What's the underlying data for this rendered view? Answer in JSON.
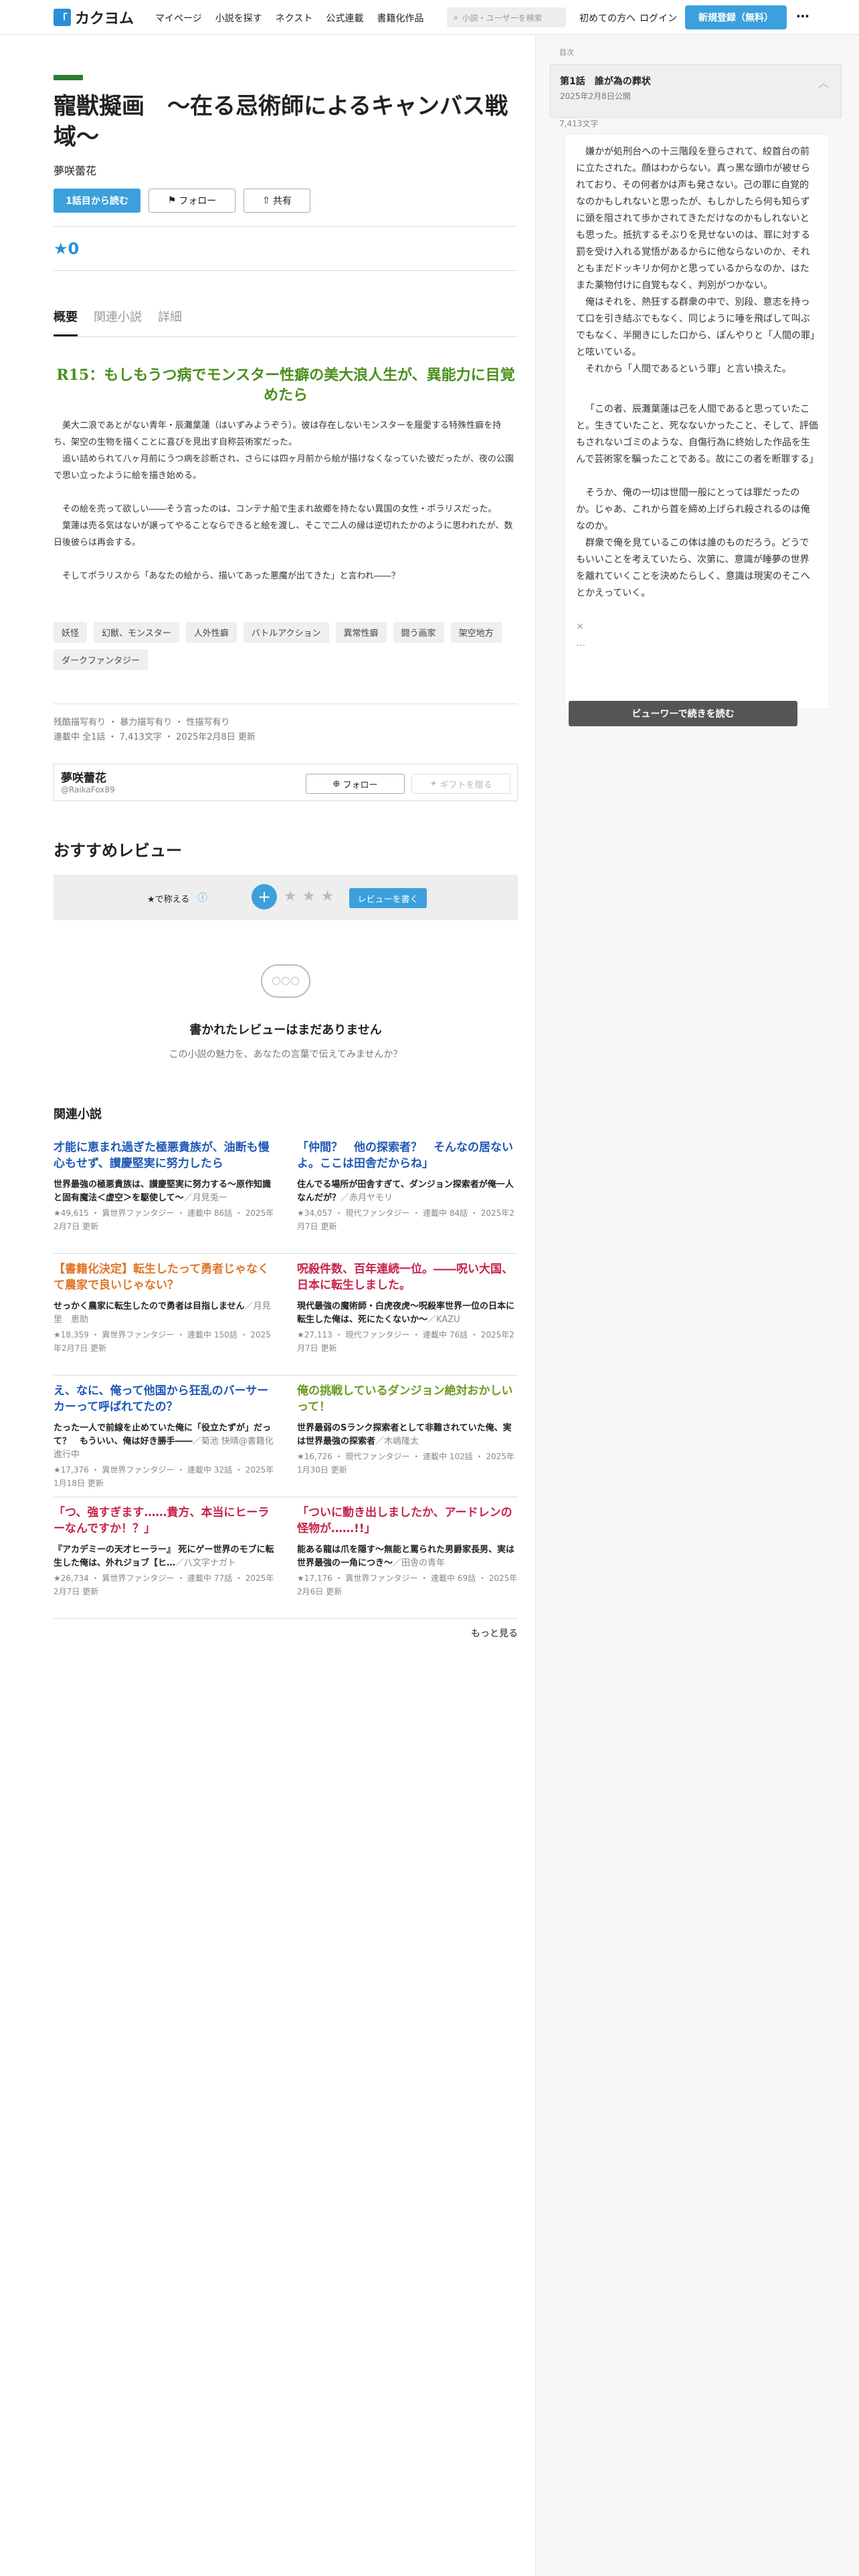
{
  "header": {
    "logo": "カクヨム",
    "nav": [
      "マイページ",
      "小説を探す",
      "ネクスト",
      "公式連載",
      "書籍化作品"
    ],
    "search_placeholder": "小説・ユーザーを検索",
    "beginner": "初めての方へ",
    "login": "ログイン",
    "signup": "新規登録（無料）"
  },
  "work": {
    "title": "寵獣擬画　〜在る忌術師によるキャンバス戦域〜",
    "author": "夢咲蕾花",
    "read_first": "1話目から読む",
    "follow": "フォロー",
    "share": "共有",
    "rating": "★0",
    "tabs": [
      "概要",
      "関連小説",
      "詳細"
    ],
    "catchphrase": "R15：もしもうつ病でモンスター性癖の美大浪人生が、異能力に目覚めたら",
    "intro": [
      "美大二浪であとがない青年・辰灘葉蓮（はいずみようぞう）。彼は存在しないモンスターを履愛する特殊性癖を持ち、架空の生物を描くことに喜びを見出す自称芸術家だった。",
      "追い詰められて八ヶ月前にうつ病を診断され、さらには四ヶ月前から絵が描けなくなっていた彼だったが、夜の公園で思い立ったように絵を描き始める。",
      "",
      "その絵を売って欲しい――そう言ったのは、コンテナ船で生まれ故郷を持たない異国の女性・ポラリスだった。",
      "葉蓮は売る気はないが譲ってやることならできると絵を渡し、そこで二人の縁は逆切れたかのように思われたが、数日後彼らは再会する。",
      "",
      "そしてポラリスから「あなたの絵から、描いてあった悪魔が出てきた」と言われ――？"
    ],
    "tags": [
      "妖怪",
      "幻獣、モンスター",
      "人外性癖",
      "バトルアクション",
      "異常性癖",
      "闘う画家",
      "架空地方",
      "ダークファンタジー"
    ],
    "notices": "残酷描写有り ・ 暴力描写有り ・ 性描写有り",
    "status": "連載中 全1話 ・ 7,413文字 ・ 2025年2月8日 更新",
    "author_box": {
      "name": "夢咲蕾花",
      "id": "@RaikaFox89",
      "follow": "フォロー",
      "gift": "ギフトを贈る"
    }
  },
  "reviews": {
    "heading": "おすすめレビュー",
    "star_label": "★で称える",
    "write": "レビューを書く",
    "empty_title": "書かれたレビューはまだありません",
    "empty_sub": "この小説の魅力を、あなたの言葉で伝えてみませんか？"
  },
  "related": {
    "heading": "関連小説",
    "items": [
      {
        "title": "才能に恵まれ過ぎた極悪貴族が、油断も慢心もせず、讃慶堅実に努力したら",
        "color": "#1f59b5",
        "sub": "世界最強の極悪貴族は、讃慶堅実に努力する〜原作知識と固有魔法＜虚空＞を駆使して〜",
        "author": "／月見兎一",
        "meta": "★49,615 ・ 異世界ファンタジー ・ 連載中 86話 ・ 2025年2月7日 更新"
      },
      {
        "title": "「仲間？　他の探索者？　そんなの居ないよ。ここは田舎だからね」",
        "color": "#1f59b5",
        "sub": "住んでる場所が田舎すぎて、ダンジョン探索者が俺一人なんだが？",
        "author": "／赤月ヤモリ",
        "meta": "★34,057 ・ 現代ファンタジー ・ 連載中 84話 ・ 2025年2月7日 更新"
      },
      {
        "title": "【書籍化決定】転生したって勇者じゃなくて農家で良いじゃない？",
        "color": "#e0762a",
        "sub": "せっかく農家に転生したので勇者は目指しません",
        "author": "／月見里　恵助",
        "meta": "★18,359 ・ 異世界ファンタジー ・ 連載中 150話 ・ 2025年2月7日 更新"
      },
      {
        "title": "呪殺件数、百年連続一位。――呪い大国、日本に転生しました。",
        "color": "#c8224a",
        "sub": "現代最強の魔術師・白虎夜虎〜呪殺率世界一位の日本に転生した俺は、死にたくないか〜",
        "author": "／KAZU",
        "meta": "★27,113 ・ 現代ファンタジー ・ 連載中 76話 ・ 2025年2月7日 更新"
      },
      {
        "title": "え、なに、俺って他国から狂乱のバーサーカーって呼ばれてたの？",
        "color": "#1f59b5",
        "sub": "たった一人で前線を止めていた俺に「役立たずが」だって？　もういい、俺は好き勝手――",
        "author": "／菊池 快晴@書籍化進行中",
        "meta": "★17,376 ・ 異世界ファンタジー ・ 連載中 32話 ・ 2025年1月18日 更新"
      },
      {
        "title": "俺の挑戦しているダンジョン絶対おかしいって！",
        "color": "#6a9a1e",
        "sub": "世界最弱のSランク探索者として非難されていた俺、実は世界最強の探索者",
        "author": "／木嶋隆太",
        "meta": "★16,726 ・ 現代ファンタジー ・ 連載中 102話 ・ 2025年1月30日 更新"
      },
      {
        "title": "「つ、強すぎます……貴方、本当にヒーラーなんですか！？」",
        "color": "#c8224a",
        "sub": "『アカデミーの天才ヒーラー』 死にゲー世界のモブに転生した俺は、外れジョブ【ヒ…",
        "author": "／八文字ナガト",
        "meta": "★26,734 ・ 異世界ファンタジー ・ 連載中 77話 ・ 2025年2月7日 更新"
      },
      {
        "title": "「ついに動き出しましたか、アードレンの怪物が……!!」",
        "color": "#c8224a",
        "sub": "能ある龍は爪を隠す〜無能と罵られた男爵家長男、実は世界最強の一角につき〜",
        "author": "／田舎の青年",
        "meta": "★17,176 ・ 異世界ファンタジー ・ 連載中 69話 ・ 2025年2月6日 更新"
      }
    ],
    "more": "もっと見る"
  },
  "side": {
    "label": "目次",
    "ep_title": "第1話　誰が為の葬状",
    "ep_date": "2025年2月8日公開",
    "ep_chars": "7,413文字",
    "text": [
      "嫌かが処刑台への十三階段を登らされて、絞首台の前に立たされた。顔はわからない。真っ黒な頭巾が被せられており、その何者かは声も発さない。己の罪に自覚的なのかもしれないと思ったが、もしかしたら何も知らずに頭を阻されて歩かされてきただけなのかもしれないとも思った。抵抗するそぶりを見せないのは、罪に対する罰を受け入れる覚悟があるからに他ならないのか、それともまだドッキリか何かと思っているからなのか、はたまた薬物付けに自覚もなく、判別がつかない。",
      "俺はそれを、熱狂する群衆の中で、別段、意志を持って口を引き結ぶでもなく、同じように唾を飛ばして叫ぶでもなく、半開きにした口から、ぽんやりと「人間の罪」と呟いている。",
      "それから「人間であるという罪」と言い換えた。",
      "",
      "「この者、辰灘葉蓮は己を人間であると思っていたこと。生きていたこと、死なないかったこと、そして、評価もされないゴミのような、自傷行為に終始した作品を生んで芸術家を騙ったことである。故にこの者を断罪する」",
      "",
      "そうか、俺の一切は世間一般にとっては罪だったのか。じゃあ、これから首を締め上げられ殺されるのは俺なのか。",
      "群衆で俺を見ているこの体は誰のものだろう。どうでもいいことを考えていたら、次第に、意識が睡夢の世界を離れていくことを決めたらしく、意識は現実のそこへとかえっていく。",
      "",
      "×",
      "…"
    ],
    "continue": "ビューワーで続きを読む"
  }
}
